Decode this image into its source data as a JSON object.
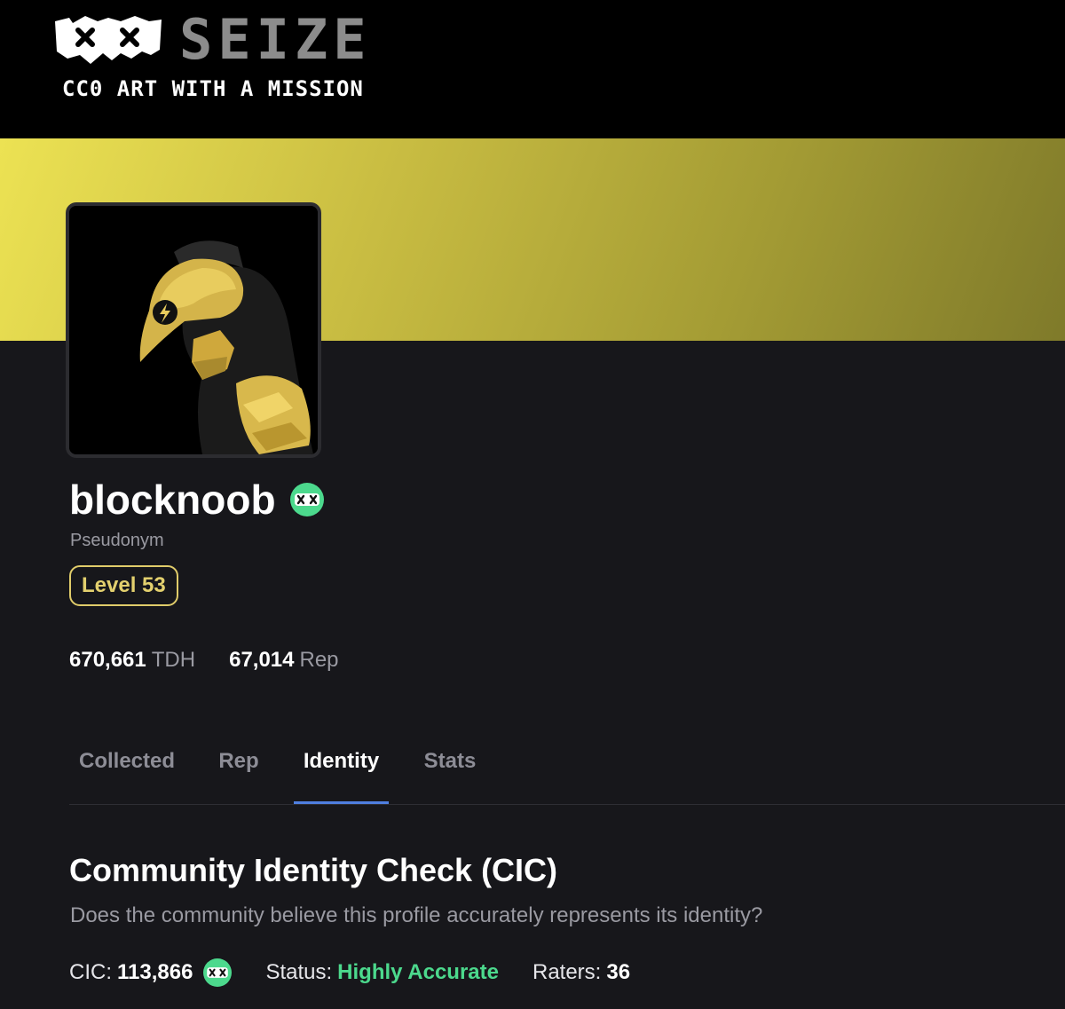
{
  "header": {
    "logo_word": "SEIZE",
    "tagline": "CC0 ART WITH A MISSION",
    "logo_icon": "xx-mask-icon"
  },
  "banner": {
    "gradient_colors": [
      "#ece253",
      "#7f7a2a"
    ]
  },
  "profile": {
    "avatar_icon": "hornet-robot-avatar",
    "name": "blocknoob",
    "verified_icon": "xx-mask-icon",
    "classification": "Pseudonym",
    "level_label": "Level 53",
    "stats": [
      {
        "value": "670,661",
        "unit": "TDH"
      },
      {
        "value": "67,014",
        "unit": "Rep"
      }
    ]
  },
  "tabs": [
    {
      "label": "Collected",
      "active": false
    },
    {
      "label": "Rep",
      "active": false
    },
    {
      "label": "Identity",
      "active": true
    },
    {
      "label": "Stats",
      "active": false
    }
  ],
  "cic": {
    "title": "Community Identity Check (CIC)",
    "description": "Does the community believe this profile accurately represents its identity?",
    "cic_label": "CIC:",
    "cic_value": "113,866",
    "status_label": "Status:",
    "status_value": "Highly Accurate",
    "raters_label": "Raters:",
    "raters_value": "36",
    "status_color": "#4cd98d",
    "accent_color": "#4f7fe0",
    "level_color": "#e3d06e"
  }
}
